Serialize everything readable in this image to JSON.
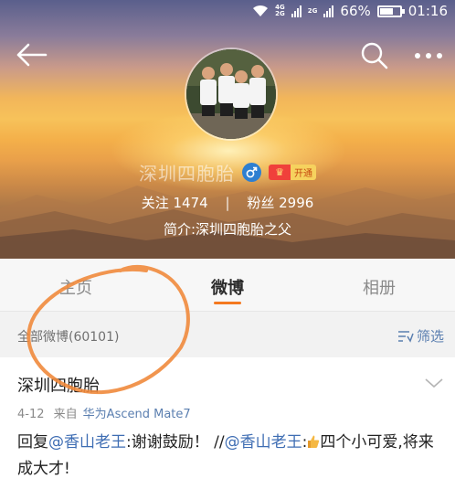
{
  "status_bar": {
    "net_top": "4G",
    "net_bottom": "2G",
    "net2_top": "2G",
    "battery": "66%",
    "battery_level": 0.66,
    "time": "01:16"
  },
  "profile": {
    "name": "深圳四胞胎",
    "vip_tag": "开通",
    "following_label": "关注",
    "following_count": "1474",
    "followers_label": "粉丝",
    "followers_count": "2996",
    "bio": "简介:深圳四胞胎之父"
  },
  "tabs": [
    {
      "label": "主页",
      "active": false
    },
    {
      "label": "微博",
      "active": true
    },
    {
      "label": "相册",
      "active": false
    }
  ],
  "filter": {
    "count_label": "全部微博(60101)",
    "filter_label": "筛选"
  },
  "post": {
    "author": "深圳四胞胎",
    "date": "4-12",
    "source_prefix": "来自",
    "source": "华为Ascend Mate7",
    "text_1": "回复",
    "mention_1": "@香山老王",
    "text_2": ":谢谢鼓励！ //",
    "mention_2": "@香山老王",
    "text_3": ":",
    "text_4": "四个小可爱,将来成大才!"
  },
  "icons": {
    "back": "arrow-left-icon",
    "search": "search-icon",
    "more": "more-dots-icon",
    "verified": "male-icon",
    "vip": "crown-icon",
    "filter": "filter-icon",
    "card_menu": "chevron-down-icon",
    "thumbs_up": "thumbs-up-icon"
  },
  "colors": {
    "accent": "#f47920",
    "link": "#3e6db3",
    "annotation": "#f08a3c"
  }
}
